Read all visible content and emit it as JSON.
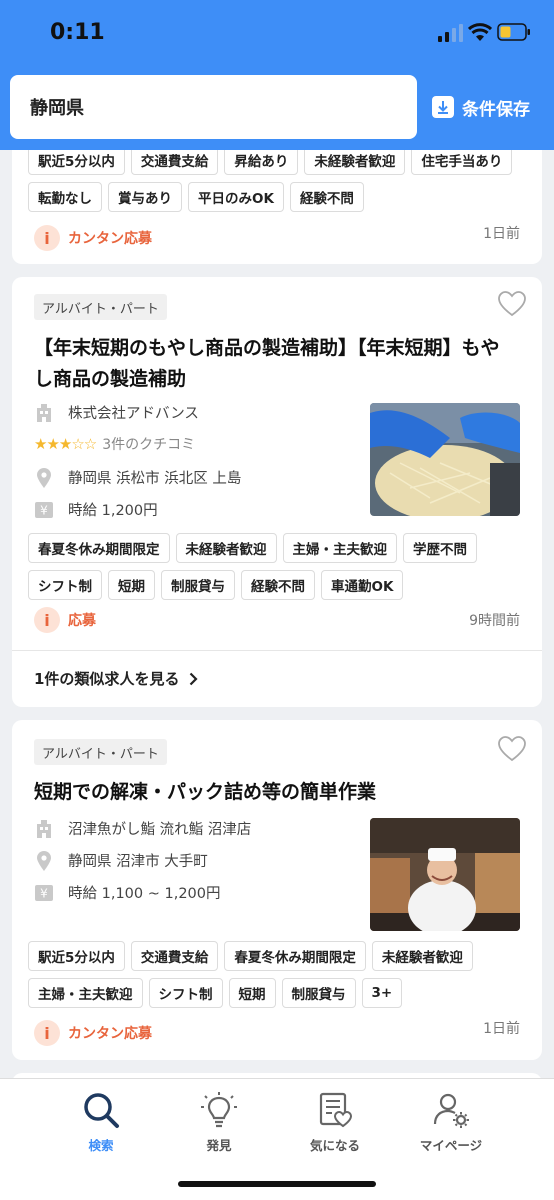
{
  "status_bar": {
    "time": "0:11"
  },
  "header": {
    "search_value": "静岡県",
    "save_label": "条件保存"
  },
  "cards": [
    {
      "tags_row1": [
        "駅近5分以内",
        "交通費支給",
        "昇給あり",
        "未経験者歓迎"
      ],
      "tags_row2": [
        "住宅手当あり",
        "転勤なし",
        "賞与あり",
        "平日のみOK",
        "経験不問"
      ],
      "apply_label": "カンタン応募",
      "posted": "1日前"
    },
    {
      "type": "アルバイト・パート",
      "title": "【年末短期のもやし商品の製造補助】【年末短期】もやし商品の製造補助",
      "company": "株式会社アドバンス",
      "rating_stars": "★★★☆☆",
      "reviews": "3件のクチコミ",
      "location": "静岡県 浜松市 浜北区 上島",
      "wage": "時給 1,200円",
      "tags": [
        "春夏冬休み期間限定",
        "未経験者歓迎",
        "主婦・主夫歓迎",
        "学歴不問",
        "シフト制",
        "短期",
        "制服貸与",
        "経験不問",
        "車通勤OK"
      ],
      "apply_label": "応募",
      "posted": "9時間前",
      "similar_label": "1件の類似求人を見る"
    },
    {
      "type": "アルバイト・パート",
      "title": "短期での解凍・パック詰め等の簡単作業",
      "company": "沼津魚がし鮨 流れ鮨 沼津店",
      "location": "静岡県 沼津市 大手町",
      "wage": "時給 1,100 ~ 1,200円",
      "tags": [
        "駅近5分以内",
        "交通費支給",
        "春夏冬休み期間限定",
        "未経験者歓迎",
        "主婦・主夫歓迎",
        "シフト制",
        "短期",
        "制服貸与",
        "3+"
      ],
      "apply_label": "カンタン応募",
      "posted": "1日前"
    }
  ],
  "bottom_nav": [
    {
      "label": "検索",
      "icon": "search-icon",
      "active": true
    },
    {
      "label": "発見",
      "icon": "lightbulb-icon",
      "active": false
    },
    {
      "label": "気になる",
      "icon": "favorite-list-icon",
      "active": false
    },
    {
      "label": "マイページ",
      "icon": "user-settings-icon",
      "active": false
    }
  ],
  "colors": {
    "header": "#3e8ef7",
    "accent_orange": "#e8643c",
    "star": "#f5b82e"
  }
}
